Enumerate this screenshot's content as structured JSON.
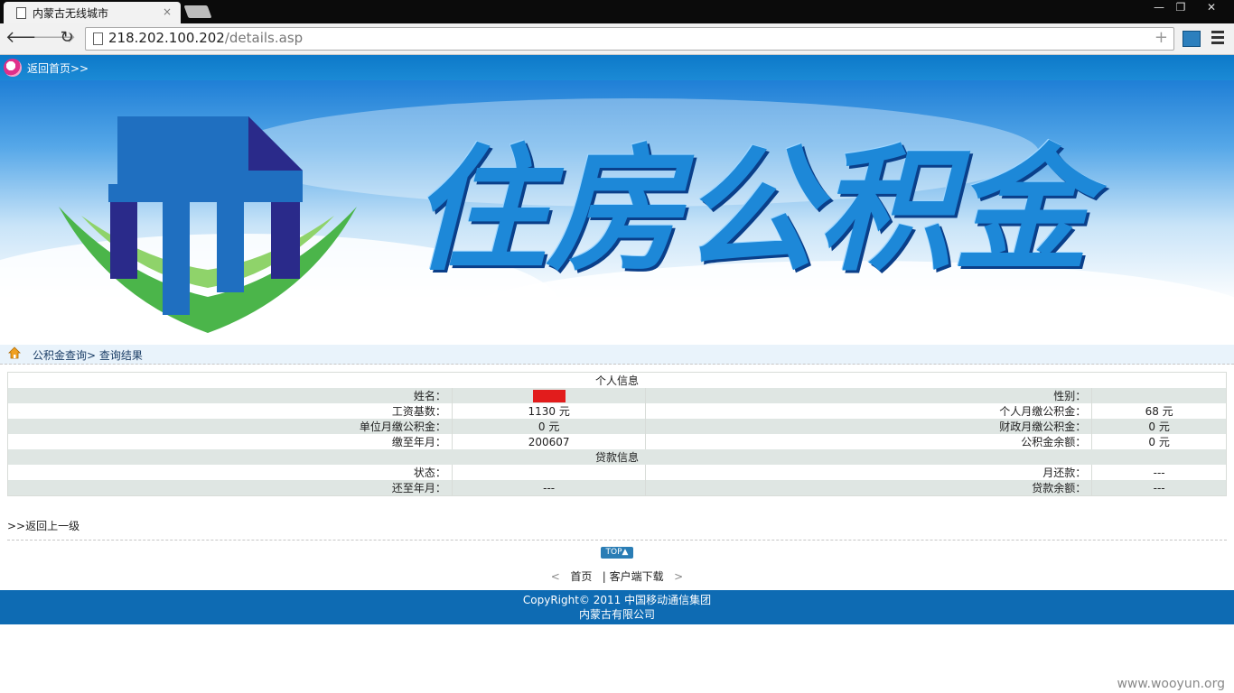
{
  "browser": {
    "tab_title": "内蒙古无线城市",
    "tab_close": "×",
    "url_host": "218.202.100.202",
    "url_path": "/details.asp"
  },
  "top": {
    "home_link": "返回首页>>"
  },
  "banner": {
    "title": "住房公积金"
  },
  "breadcrumb": {
    "text": "公积金查询> 查询结果"
  },
  "table": {
    "section_personal": "个人信息",
    "name_label": "姓名：",
    "gender_label": "性别：",
    "gender_value": "",
    "wage_label": "工资基数：",
    "wage_value": "1130 元",
    "personal_monthly_label": "个人月缴公积金：",
    "personal_monthly_value": "68 元",
    "unit_monthly_label": "单位月缴公积金：",
    "unit_monthly_value": "0 元",
    "finance_monthly_label": "财政月缴公积金：",
    "finance_monthly_value": "0 元",
    "paid_until_label": "缴至年月：",
    "paid_until_value": "200607",
    "balance_label": "公积金余额：",
    "balance_value": "0 元",
    "section_loan": "贷款信息",
    "status_label": "状态：",
    "status_value": "",
    "monthly_repay_label": "月还款：",
    "monthly_repay_value": "---",
    "repay_until_label": "还至年月：",
    "repay_until_value": "---",
    "loan_balance_label": "贷款余额：",
    "loan_balance_value": "---"
  },
  "back_link": ">>返回上一级",
  "top_button": "TOP▲",
  "footer": {
    "left_arrow": "<",
    "home": "首页",
    "separator": "|",
    "download": "客户端下载",
    "right_arrow": ">",
    "copyright_line1": "CopyRight© 2011 中国移动通信集团",
    "copyright_line2": "内蒙古有限公司"
  },
  "watermark": "www.wooyun.org"
}
